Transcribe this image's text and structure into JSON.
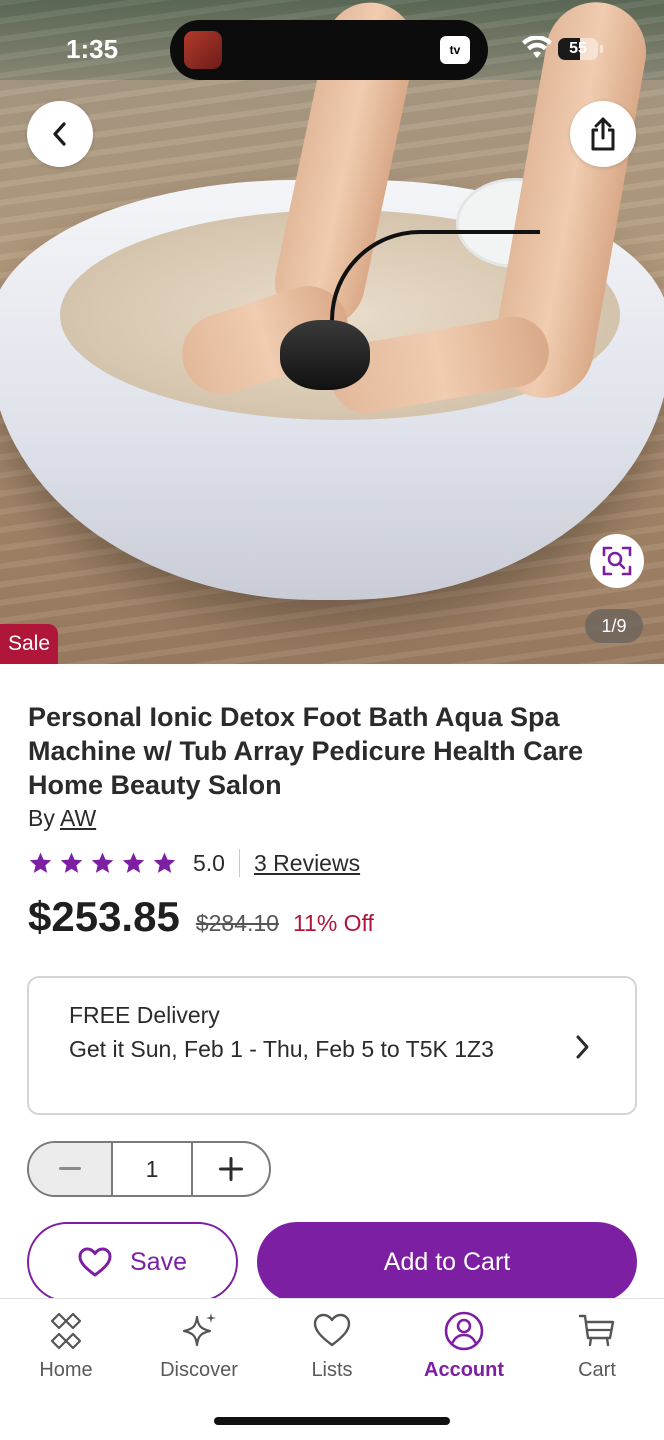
{
  "status_bar": {
    "time": "1:35",
    "battery": "55",
    "battery_level_percent": 55
  },
  "hero": {
    "image_alt": "Feet in white ionic detox foot bath tub",
    "image_counter": "1/9",
    "sale_badge": "Sale"
  },
  "product": {
    "title": "Personal Ionic Detox Foot Bath Aqua Spa Machine w/ Tub Array Pedicure Health Care Home Beauty Salon",
    "by_prefix": "By",
    "brand": "AW",
    "rating_value": "5.0",
    "rating_stars": 5,
    "reviews_label": "3 Reviews",
    "price": "$253.85",
    "original_price": "$284.10",
    "discount": "11% Off"
  },
  "delivery": {
    "headline": "FREE Delivery",
    "detail": "Get it Sun, Feb 1 - Thu, Feb 5 to T5K 1Z3"
  },
  "quantity": {
    "value": "1"
  },
  "actions": {
    "save_label": "Save",
    "add_to_cart_label": "Add to Cart"
  },
  "colors": {
    "accent": "#7c1fa3",
    "sale": "#b0163a"
  },
  "bottom_nav": {
    "items": [
      {
        "label": "Home",
        "icon": "home-icon"
      },
      {
        "label": "Discover",
        "icon": "sparkle-icon"
      },
      {
        "label": "Lists",
        "icon": "heart-icon"
      },
      {
        "label": "Account",
        "icon": "account-icon",
        "active": true
      },
      {
        "label": "Cart",
        "icon": "cart-icon"
      }
    ]
  }
}
